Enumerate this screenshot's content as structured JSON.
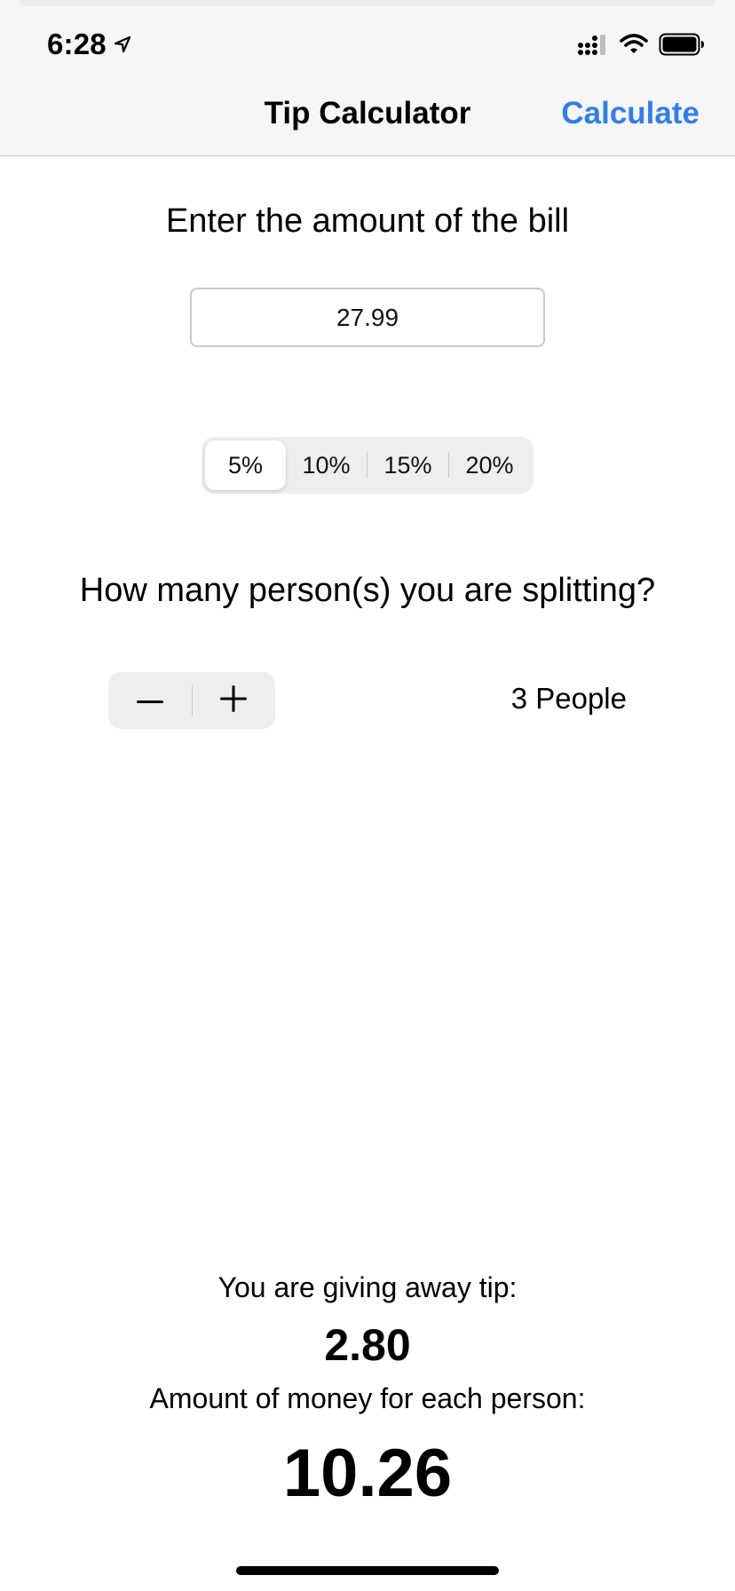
{
  "status_bar": {
    "time": "6:28",
    "icons": [
      "location-arrow-icon",
      "cellular-signal-icon",
      "wifi-icon",
      "battery-icon"
    ]
  },
  "nav": {
    "title": "Tip Calculator",
    "action_label": "Calculate",
    "accent_color": "#2f7ef0"
  },
  "bill": {
    "prompt": "Enter the amount of the bill",
    "value": "27.99"
  },
  "tip_options": {
    "options": [
      "5%",
      "10%",
      "15%",
      "20%"
    ],
    "selected": "5%"
  },
  "split": {
    "prompt": "How many person(s) you are splitting?",
    "decrement_icon": "minus-icon",
    "increment_icon": "plus-icon",
    "people_label": "3 People"
  },
  "results": {
    "tip_label": "You are giving away tip:",
    "tip_value": "2.80",
    "per_person_label": "Amount of money for each person:",
    "per_person_value": "10.26"
  }
}
